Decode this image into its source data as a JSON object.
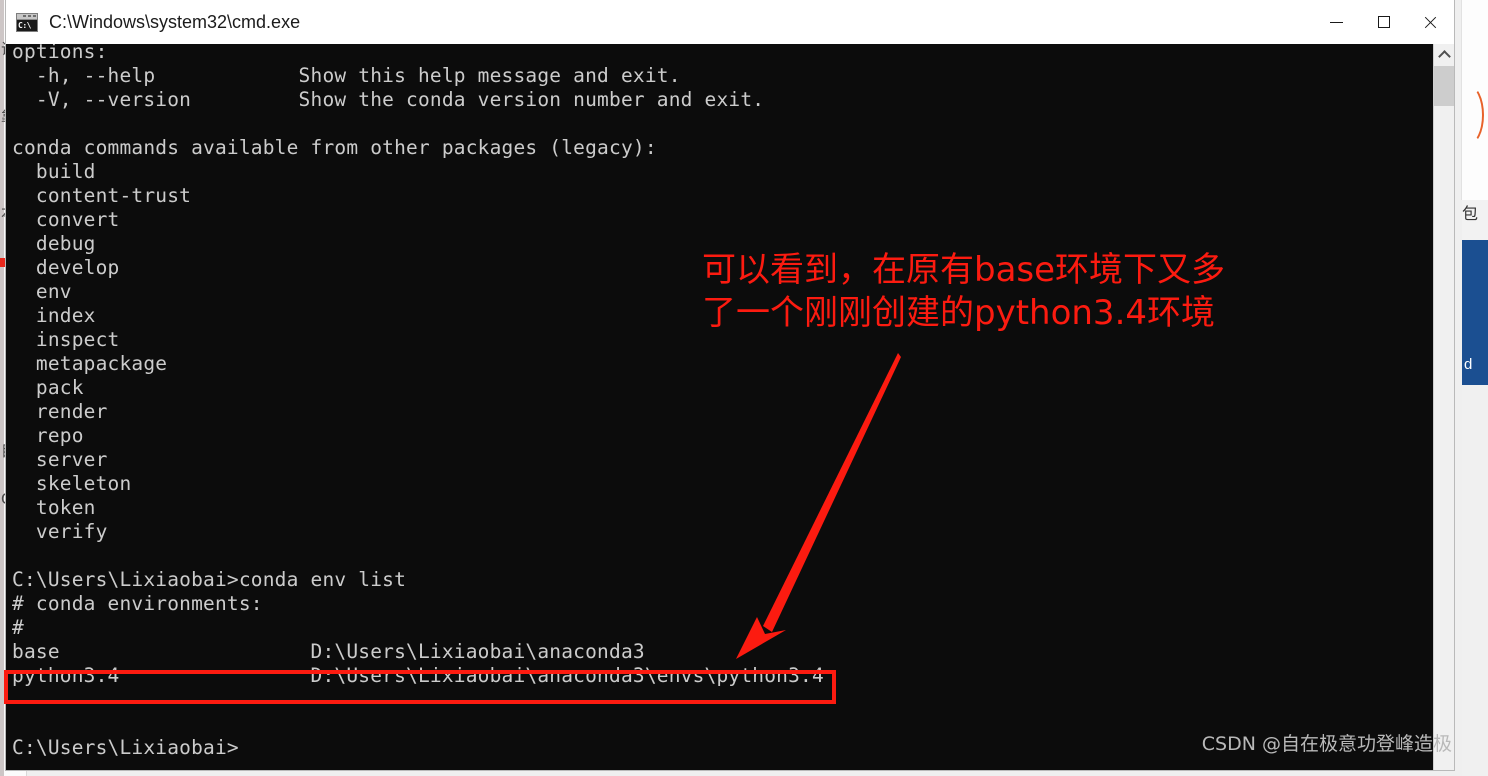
{
  "window": {
    "title": "C:\\Windows\\system32\\cmd.exe",
    "icon": "cmd-window-icon",
    "icon_text": "C:\\",
    "controls": {
      "minimize_label": "Minimize",
      "maximize_label": "Maximize",
      "close_label": "Close"
    }
  },
  "console": {
    "background_color": "#0c0c0c",
    "text_color": "#cccccc",
    "content": "options:\n  -h, --help            Show this help message and exit.\n  -V, --version         Show the conda version number and exit.\n\nconda commands available from other packages (legacy):\n  build\n  content-trust\n  convert\n  debug\n  develop\n  env\n  index\n  inspect\n  metapackage\n  pack\n  render\n  repo\n  server\n  skeleton\n  token\n  verify\n\nC:\\Users\\Lixiaobai>conda env list\n# conda environments:\n#\nbase                     D:\\Users\\Lixiaobai\\anaconda3\npython3.4                D:\\Users\\Lixiaobai\\anaconda3\\envs\\python3.4\n\n\nC:\\Users\\Lixiaobai>",
    "lines": [
      "options:",
      "  -h, --help            Show this help message and exit.",
      "  -V, --version         Show the conda version number and exit.",
      "",
      "conda commands available from other packages (legacy):",
      "  build",
      "  content-trust",
      "  convert",
      "  debug",
      "  develop",
      "  env",
      "  index",
      "  inspect",
      "  metapackage",
      "  pack",
      "  render",
      "  repo",
      "  server",
      "  skeleton",
      "  token",
      "  verify",
      "",
      "C:\\Users\\Lixiaobai>conda env list",
      "# conda environments:",
      "#",
      "base                     D:\\Users\\Lixiaobai\\anaconda3",
      "python3.4                D:\\Users\\Lixiaobai\\anaconda3\\envs\\python3.4",
      "",
      "",
      "C:\\Users\\Lixiaobai>"
    ],
    "command_entered": "conda env list",
    "prompt": "C:\\Users\\Lixiaobai>",
    "conda_environments": [
      {
        "name": "base",
        "path": "D:\\Users\\Lixiaobai\\anaconda3"
      },
      {
        "name": "python3.4",
        "path": "D:\\Users\\Lixiaobai\\anaconda3\\envs\\python3.4"
      }
    ],
    "legacy_commands": [
      "build",
      "content-trust",
      "convert",
      "debug",
      "develop",
      "env",
      "index",
      "inspect",
      "metapackage",
      "pack",
      "render",
      "repo",
      "server",
      "skeleton",
      "token",
      "verify"
    ],
    "options": [
      {
        "flags": "-h, --help",
        "description": "Show this help message and exit."
      },
      {
        "flags": "-V, --version",
        "description": "Show the conda version number and exit."
      }
    ]
  },
  "scrollbar": {
    "up_arrow": "chevron-up-icon"
  },
  "annotation": {
    "color": "#fc1b10",
    "text": "可以看到，在原有base环境下又多\n了一个刚刚创建的python3.4环境",
    "arrow": "red-arrow-pointing-to-python34-row",
    "highlight_target": "python3.4"
  },
  "watermark": {
    "text": "CSDN @自在极意功登峰造极"
  },
  "background": {
    "left_marks": [
      "证",
      "靠",
      "本",
      "目",
      "O"
    ],
    "right_text": "包",
    "right_panel_text": "d",
    "accent_blue": "#1b4f91",
    "accent_red": "#e8281c",
    "accent_orange": "#e8622a"
  }
}
